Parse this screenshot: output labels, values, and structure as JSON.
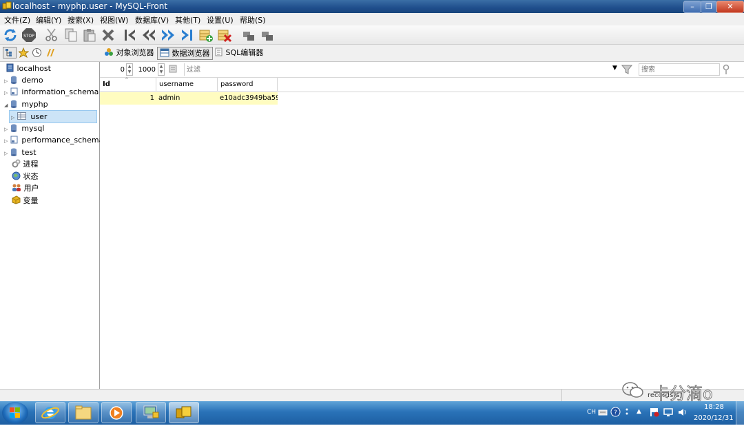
{
  "window": {
    "title": "localhost - myphp.user - MySQL-Front",
    "min_glyph": "–",
    "max_glyph": "❐",
    "close_glyph": "✕"
  },
  "menu": [
    "文件(Z)",
    "编辑(Y)",
    "搜索(X)",
    "视图(W)",
    "数据库(V)",
    "其他(T)",
    "设置(U)",
    "帮助(S)"
  ],
  "viewtabs": {
    "object_browser": "对象浏览器",
    "data_browser": "数据浏览器",
    "sql_editor": "SQL编辑器"
  },
  "tree": {
    "root": "localhost",
    "items": [
      {
        "label": "demo"
      },
      {
        "label": "information_schema"
      },
      {
        "label": "myphp"
      },
      {
        "label": "user"
      },
      {
        "label": "mysql"
      },
      {
        "label": "performance_schema"
      },
      {
        "label": "test"
      },
      {
        "label": "进程"
      },
      {
        "label": "状态"
      },
      {
        "label": "用户"
      },
      {
        "label": "变量"
      }
    ]
  },
  "filter": {
    "offset": "0",
    "limit": "1000",
    "filter_placeholder": "过滤",
    "search_placeholder": "搜索"
  },
  "grid": {
    "columns": [
      "Id",
      "username",
      "password"
    ],
    "rows": [
      {
        "id": "1",
        "username": "admin",
        "password": "e10adc3949ba59"
      }
    ]
  },
  "statusbar": {
    "records": "records(s)",
    "watermark": "卡分滴o"
  },
  "taskbar": {
    "lang": "CH",
    "time": "18:28",
    "date": "2020/12/31"
  },
  "colors": {
    "selected_cell": "#fffcc0",
    "title_bar": "#1f4e8c",
    "taskbar": "#2a72b8"
  }
}
